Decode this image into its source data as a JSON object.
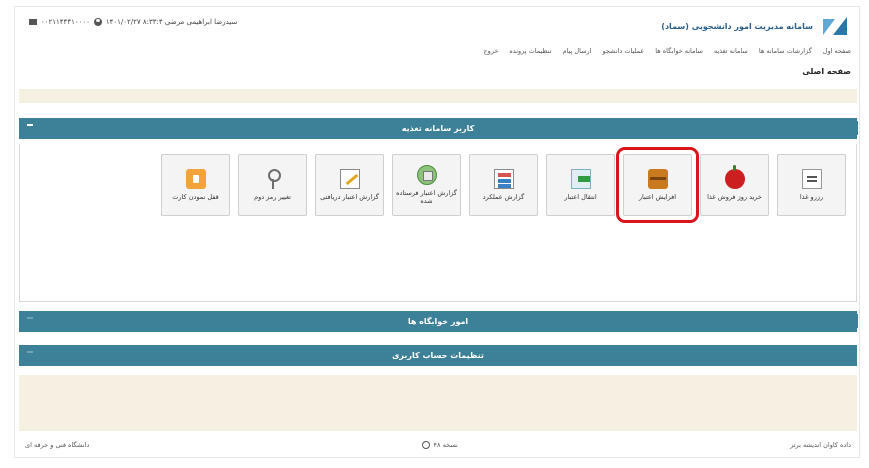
{
  "header": {
    "brand_title": "سامانه مدیریت امور دانشجویی (سماد)",
    "user_text": "سیدرضا ابراهیمی مرضی ۸:۳۳:۴ ۱۴۰۱/۰۲/۲۷",
    "phone": "۰۰۲۱۱۴۴۴۱۰۰۰۰"
  },
  "nav": [
    "صفحه اول",
    "گزارشات سامانه ها",
    "سامانه تغذیه",
    "سامانه خوابگاه ها",
    "عملیات دانشجو",
    "ارسال پیام",
    "تنظیمات پرونده",
    "خروج"
  ],
  "page_title": "صفحه اصلی",
  "panel_food": {
    "title": "کاربر سامانه تغذیه",
    "tiles": [
      {
        "label": "رزرو غذا",
        "icon": "paper-icon"
      },
      {
        "label": "خرید روز فروش غذا",
        "icon": "apple-icon"
      },
      {
        "label": "افزایش اعتبار",
        "icon": "chest-icon"
      },
      {
        "label": "انتقال اعتبار",
        "icon": "transfer-icon"
      },
      {
        "label": "گزارش عملکرد",
        "icon": "report-icon"
      },
      {
        "label": "گزارش اعتبار فرستاده شده",
        "icon": "sent-credit-icon"
      },
      {
        "label": "گزارش اعتبار دریافتی",
        "icon": "received-credit-icon"
      },
      {
        "label": "تغییر رمز دوم",
        "icon": "keys-icon"
      },
      {
        "label": "قفل نمودن کارت",
        "icon": "lock-icon"
      }
    ]
  },
  "panel_dorm": {
    "title": "امور خوابگاه ها"
  },
  "panel_account": {
    "title": "تنظیمات حساب کاربری"
  },
  "footer": {
    "right": "داده کاوان اندیشه برتر",
    "center": "نسخه ۴۸",
    "left": "دانشگاه فنی و حرفه ای"
  },
  "colors": {
    "panel_header": "#3d8198",
    "band": "#f6f0e3",
    "highlight": "#d9141b"
  }
}
